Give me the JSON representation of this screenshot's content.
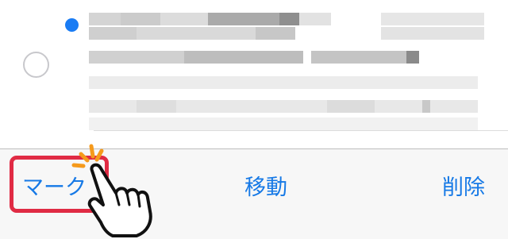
{
  "colors": {
    "accent": "#1679e6",
    "unread_dot": "#1a7cf4",
    "highlight": "#e02b44",
    "tap_burst": "#f59a1c"
  },
  "toolbar": {
    "mark_label": "マーク",
    "move_label": "移動",
    "delete_label": "削除"
  },
  "icons": {
    "unread": "unread-dot-icon",
    "select": "select-circle-icon",
    "pointer": "pointing-hand-icon",
    "tap": "tap-burst-icon"
  }
}
